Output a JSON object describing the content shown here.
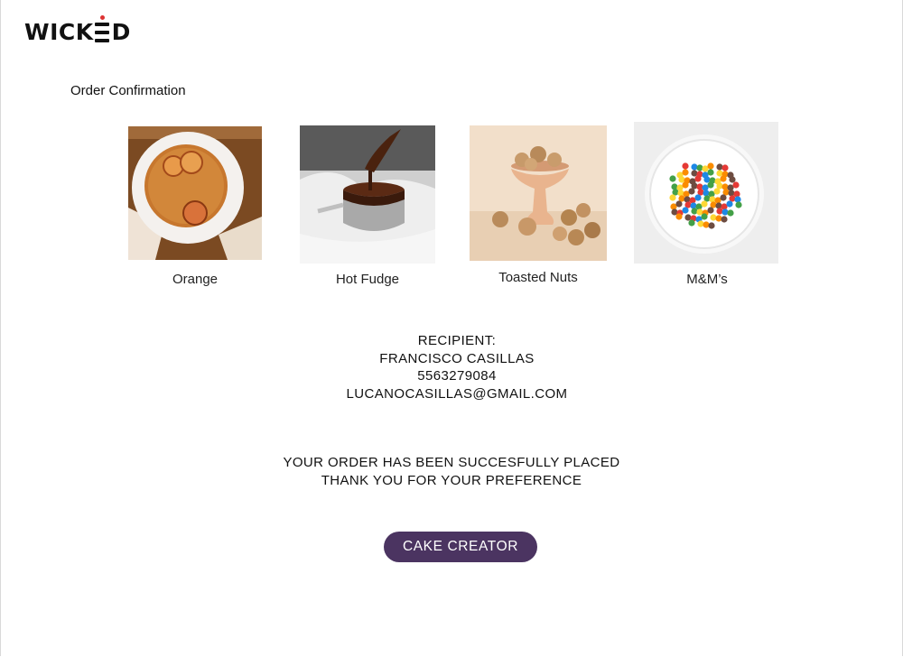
{
  "brand": {
    "logo_text_left": "WICK",
    "logo_text_right": "D",
    "accent_color": "#d33333"
  },
  "page": {
    "title": "Order Confirmation"
  },
  "products": [
    {
      "label": "Orange",
      "image": "orange-cake-photo"
    },
    {
      "label": "Hot Fudge",
      "image": "hot-fudge-photo"
    },
    {
      "label": "Toasted Nuts",
      "image": "toasted-nuts-photo"
    },
    {
      "label": "M&M’s",
      "image": "mms-candy-photo"
    }
  ],
  "recipient": {
    "heading": "RECIPIENT:",
    "name": "FRANCISCO CASILLAS",
    "phone": "5563279084",
    "email": "LUCANOCASILLAS@GMAIL.COM"
  },
  "message": {
    "line1": "YOUR ORDER HAS BEEN SUCCESFULLY PLACED",
    "line2": "THANK YOU FOR YOUR PREFERENCE"
  },
  "cta": {
    "label": "CAKE CREATOR",
    "color": "#4b3461"
  }
}
